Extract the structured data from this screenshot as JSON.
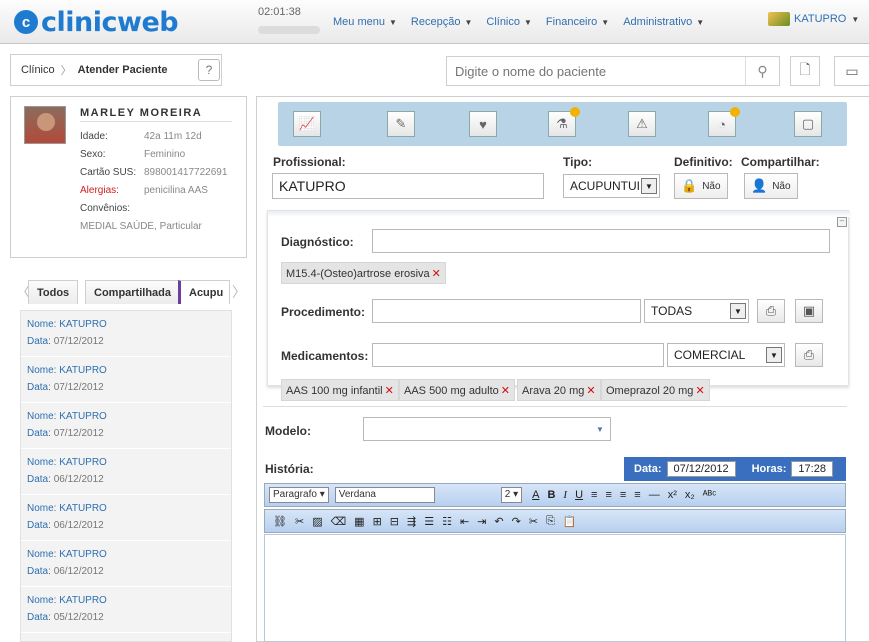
{
  "header": {
    "logo_badge": "c",
    "logo_text": "clinicweb",
    "clock": "02:01:38",
    "menu": [
      {
        "label": "Meu menu"
      },
      {
        "label": "Recepção"
      },
      {
        "label": "Clínico"
      },
      {
        "label": "Financeiro"
      },
      {
        "label": "Administrativo"
      }
    ],
    "user": "KATUPRO"
  },
  "breadcrumb": {
    "parent": "Clínico",
    "current": "Atender Paciente"
  },
  "search": {
    "placeholder": "Digite o nome do paciente"
  },
  "patient": {
    "name": "MARLEY MOREIRA",
    "fields": {
      "idade_label": "Idade:",
      "idade": "42a 11m 12d",
      "sexo_label": "Sexo:",
      "sexo": "Feminino",
      "sus_label": "Cartão SUS:",
      "sus": "898001417722691",
      "alergias_label": "Alergias:",
      "alergias": "penicilina AAS",
      "convenios_label": "Convênios:",
      "convenios": "MEDIAL SAÚDE, Particular"
    }
  },
  "tabs": {
    "todos": "Todos",
    "compartilhada": "Compartilhada",
    "acupuntura": "Acupu"
  },
  "history": {
    "nome_label": "Nome:",
    "data_label": "Data:",
    "items": [
      {
        "nome": "KATUPRO",
        "data": "07/12/2012"
      },
      {
        "nome": "KATUPRO",
        "data": "07/12/2012"
      },
      {
        "nome": "KATUPRO",
        "data": "07/12/2012"
      },
      {
        "nome": "KATUPRO",
        "data": "06/12/2012"
      },
      {
        "nome": "KATUPRO",
        "data": "06/12/2012"
      },
      {
        "nome": "KATUPRO",
        "data": "06/12/2012"
      },
      {
        "nome": "KATUPRO",
        "data": "05/12/2012"
      }
    ]
  },
  "form": {
    "profissional_label": "Profissional:",
    "profissional": "KATUPRO",
    "tipo_label": "Tipo:",
    "tipo": "ACUPUNTUI",
    "definitivo_label": "Definitivo:",
    "definitivo": "Não",
    "compartilhar_label": "Compartilhar:",
    "compartilhar": "Não",
    "diagnostico_label": "Diagnóstico:",
    "diagnostico_chip": "M15.4-(Osteo)artrose erosiva",
    "procedimento_label": "Procedimento:",
    "procedimento_filter": "TODAS",
    "medicamentos_label": "Medicamentos:",
    "medicamentos_filter": "COMERCIAL",
    "med_chips": [
      "AAS 100 mg infantil",
      "AAS 500 mg adulto",
      "Arava 20 mg",
      "Omeprazol 20 mg"
    ],
    "modelo_label": "Modelo:",
    "historia_label": "História:",
    "data_label": "Data:",
    "data": "07/12/2012",
    "horas_label": "Horas:",
    "horas": "17:28"
  },
  "editor": {
    "format": "Paragrafo",
    "font": "Verdana",
    "size": "2"
  },
  "colors": {
    "brand": "#1f7bd0",
    "link": "#2f6fb0",
    "toolstrip": "#b8d3e6",
    "datebar": "#3a6fbf",
    "alert": "#d02020"
  }
}
